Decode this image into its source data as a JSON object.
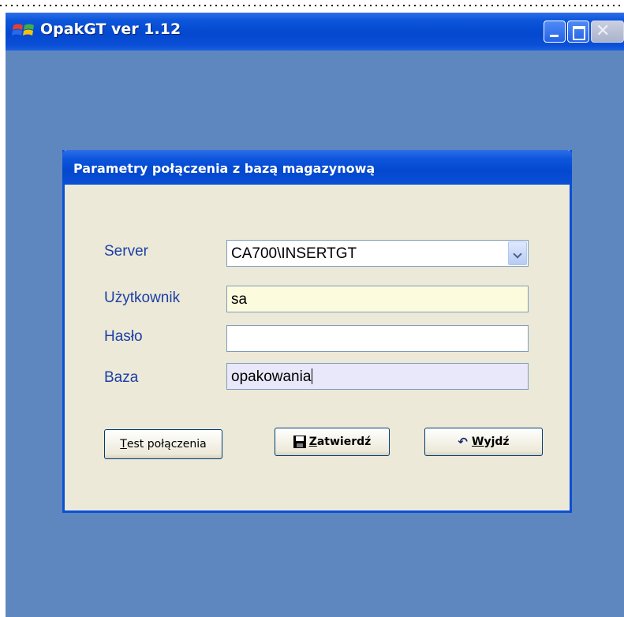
{
  "window": {
    "title": "OpakGT ver 1.12",
    "icon": "windows-flag-icon",
    "close_symbol": "✕"
  },
  "dialog": {
    "title": "Parametry połączenia z bazą magazynową",
    "fields": {
      "server": {
        "label": "Server",
        "value": "CA700\\INSERTGT"
      },
      "user": {
        "label": "Użytkownik",
        "value": "sa"
      },
      "password": {
        "label": "Hasło",
        "value": ""
      },
      "database": {
        "label": "Baza",
        "value": "opakowania"
      }
    },
    "buttons": {
      "test": {
        "mnemonic": "T",
        "rest": "est połączenia"
      },
      "confirm": {
        "mnemonic": "Z",
        "rest": "atwierdź",
        "icon": "floppy-disk-icon"
      },
      "exit": {
        "mnemonic": "W",
        "rest": "yjdź",
        "icon": "undo-arrow-icon",
        "symbol": "↶"
      }
    }
  },
  "colors": {
    "title_bar": "#0348cf",
    "desktop": "#5f87bf",
    "dialog_bg": "#ece9d8",
    "label_text": "#1c3fa6",
    "user_field_bg": "#fdfbdd",
    "database_field_bg": "#e8e8fa"
  }
}
